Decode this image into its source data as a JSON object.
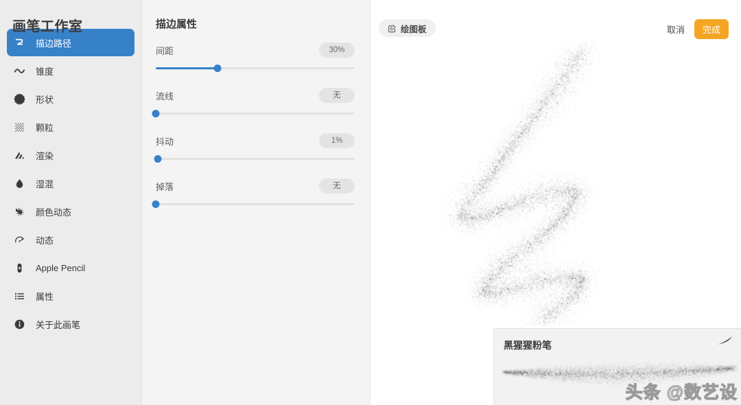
{
  "sidebar": {
    "title": "画笔工作室",
    "items": [
      {
        "label": "描边路径",
        "icon": "stroke-path-icon",
        "active": true
      },
      {
        "label": "锥度",
        "icon": "taper-wave-icon",
        "active": false
      },
      {
        "label": "形状",
        "icon": "shape-starburst-icon",
        "active": false
      },
      {
        "label": "颗粒",
        "icon": "grain-dots-icon",
        "active": false
      },
      {
        "label": "渲染",
        "icon": "render-stripes-icon",
        "active": false
      },
      {
        "label": "湿混",
        "icon": "wet-mix-droplet-icon",
        "active": false
      },
      {
        "label": "颜色动态",
        "icon": "color-dynamics-splat-icon",
        "active": false
      },
      {
        "label": "动态",
        "icon": "dynamics-gauge-icon",
        "active": false
      },
      {
        "label": "Apple Pencil",
        "icon": "apple-pencil-icon",
        "active": false
      },
      {
        "label": "属性",
        "icon": "properties-list-icon",
        "active": false
      },
      {
        "label": "关于此画笔",
        "icon": "about-info-icon",
        "active": false
      }
    ]
  },
  "properties": {
    "title": "描边属性",
    "sliders": [
      {
        "label": "间距",
        "value": "30%",
        "percent": 31
      },
      {
        "label": "流线",
        "value": "无",
        "percent": 0
      },
      {
        "label": "抖动",
        "value": "1%",
        "percent": 1
      },
      {
        "label": "掉落",
        "value": "无",
        "percent": 0
      }
    ]
  },
  "toolbar": {
    "drawpad_label": "绘图板",
    "drawpad_icon": "pencil-square-icon",
    "cancel_label": "取消",
    "done_label": "完成"
  },
  "brush_card": {
    "name": "黑猩猩粉笔",
    "mark_icon": "brush-stroke-mark-icon",
    "watermark": "头条 @数艺设"
  },
  "colors": {
    "accent_blue": "#3781c9",
    "accent_orange": "#f5a524",
    "sidebar_bg": "#ececec",
    "panel_bg": "#f4f4f4",
    "canvas_bg": "#ffffff",
    "pill_bg": "#e4e4e4",
    "text_dark": "#3a3a3a",
    "text_muted": "#6a6a6a"
  }
}
